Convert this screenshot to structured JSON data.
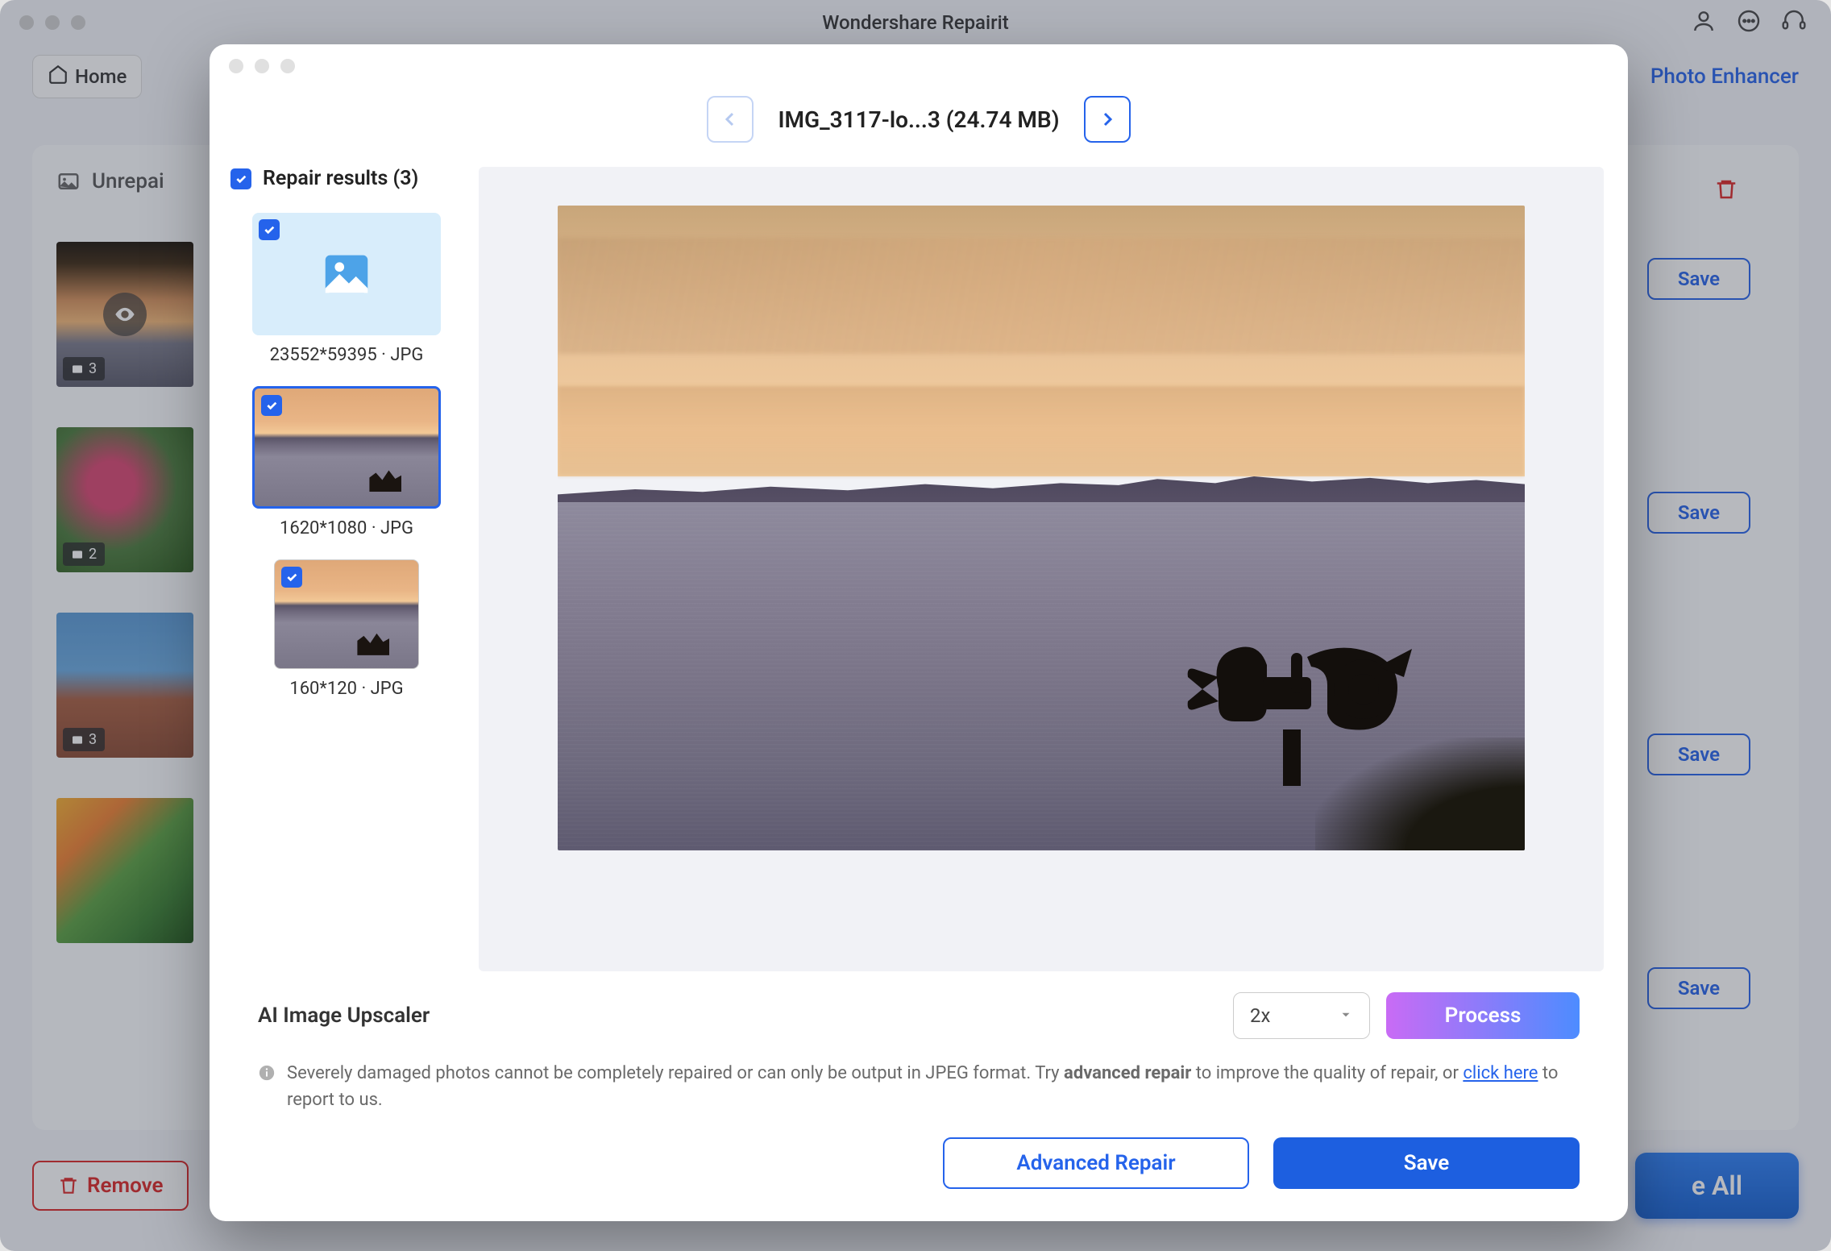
{
  "app": {
    "title": "Wondershare Repairit"
  },
  "toolbar": {
    "home": "Home",
    "enhancer": "Photo Enhancer"
  },
  "bg": {
    "section_title": "Unrepai",
    "thumb_badges": [
      "3",
      "2",
      "3"
    ],
    "save": "Save",
    "remove": "Remove",
    "save_all": "e All"
  },
  "modal": {
    "file_title": "IMG_3117-lo...3 (24.74 MB)",
    "results_title": "Repair results (3)",
    "results": [
      {
        "label": "23552*59395 · JPG"
      },
      {
        "label": "1620*1080 · JPG"
      },
      {
        "label": "160*120 · JPG"
      }
    ],
    "upscaler_title": "AI Image Upscaler",
    "scale": "2x",
    "process": "Process",
    "notice_pre": "Severely damaged photos cannot be completely repaired or can only be output in JPEG format. Try ",
    "notice_bold": "advanced repair",
    "notice_mid": " to improve the quality of repair, or ",
    "notice_link": "click here",
    "notice_post": " to report to us.",
    "advanced_repair": "Advanced Repair",
    "save": "Save"
  }
}
